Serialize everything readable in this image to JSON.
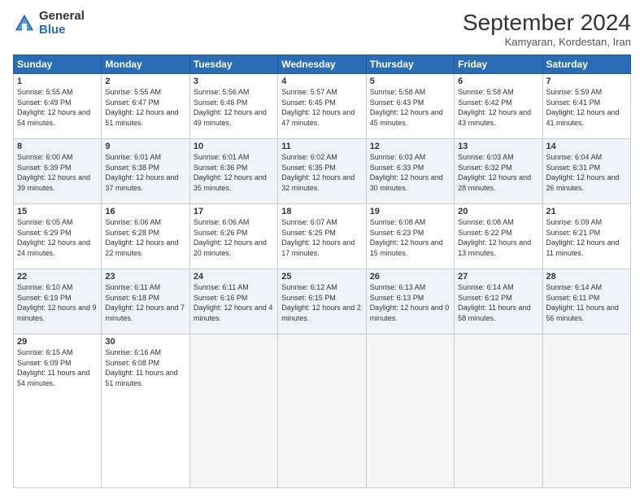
{
  "logo": {
    "general": "General",
    "blue": "Blue"
  },
  "title": "September 2024",
  "subtitle": "Kamyaran, Kordestan, Iran",
  "weekdays": [
    "Sunday",
    "Monday",
    "Tuesday",
    "Wednesday",
    "Thursday",
    "Friday",
    "Saturday"
  ],
  "weeks": [
    [
      {
        "day": "1",
        "sunrise": "5:55 AM",
        "sunset": "6:49 PM",
        "daylight": "12 hours and 54 minutes."
      },
      {
        "day": "2",
        "sunrise": "5:55 AM",
        "sunset": "6:47 PM",
        "daylight": "12 hours and 51 minutes."
      },
      {
        "day": "3",
        "sunrise": "5:56 AM",
        "sunset": "6:46 PM",
        "daylight": "12 hours and 49 minutes."
      },
      {
        "day": "4",
        "sunrise": "5:57 AM",
        "sunset": "6:45 PM",
        "daylight": "12 hours and 47 minutes."
      },
      {
        "day": "5",
        "sunrise": "5:58 AM",
        "sunset": "6:43 PM",
        "daylight": "12 hours and 45 minutes."
      },
      {
        "day": "6",
        "sunrise": "5:58 AM",
        "sunset": "6:42 PM",
        "daylight": "12 hours and 43 minutes."
      },
      {
        "day": "7",
        "sunrise": "5:59 AM",
        "sunset": "6:41 PM",
        "daylight": "12 hours and 41 minutes."
      }
    ],
    [
      {
        "day": "8",
        "sunrise": "6:00 AM",
        "sunset": "6:39 PM",
        "daylight": "12 hours and 39 minutes."
      },
      {
        "day": "9",
        "sunrise": "6:01 AM",
        "sunset": "6:38 PM",
        "daylight": "12 hours and 37 minutes."
      },
      {
        "day": "10",
        "sunrise": "6:01 AM",
        "sunset": "6:36 PM",
        "daylight": "12 hours and 35 minutes."
      },
      {
        "day": "11",
        "sunrise": "6:02 AM",
        "sunset": "6:35 PM",
        "daylight": "12 hours and 32 minutes."
      },
      {
        "day": "12",
        "sunrise": "6:03 AM",
        "sunset": "6:33 PM",
        "daylight": "12 hours and 30 minutes."
      },
      {
        "day": "13",
        "sunrise": "6:03 AM",
        "sunset": "6:32 PM",
        "daylight": "12 hours and 28 minutes."
      },
      {
        "day": "14",
        "sunrise": "6:04 AM",
        "sunset": "6:31 PM",
        "daylight": "12 hours and 26 minutes."
      }
    ],
    [
      {
        "day": "15",
        "sunrise": "6:05 AM",
        "sunset": "6:29 PM",
        "daylight": "12 hours and 24 minutes."
      },
      {
        "day": "16",
        "sunrise": "6:06 AM",
        "sunset": "6:28 PM",
        "daylight": "12 hours and 22 minutes."
      },
      {
        "day": "17",
        "sunrise": "6:06 AM",
        "sunset": "6:26 PM",
        "daylight": "12 hours and 20 minutes."
      },
      {
        "day": "18",
        "sunrise": "6:07 AM",
        "sunset": "6:25 PM",
        "daylight": "12 hours and 17 minutes."
      },
      {
        "day": "19",
        "sunrise": "6:08 AM",
        "sunset": "6:23 PM",
        "daylight": "12 hours and 15 minutes."
      },
      {
        "day": "20",
        "sunrise": "6:08 AM",
        "sunset": "6:22 PM",
        "daylight": "12 hours and 13 minutes."
      },
      {
        "day": "21",
        "sunrise": "6:09 AM",
        "sunset": "6:21 PM",
        "daylight": "12 hours and 11 minutes."
      }
    ],
    [
      {
        "day": "22",
        "sunrise": "6:10 AM",
        "sunset": "6:19 PM",
        "daylight": "12 hours and 9 minutes."
      },
      {
        "day": "23",
        "sunrise": "6:11 AM",
        "sunset": "6:18 PM",
        "daylight": "12 hours and 7 minutes."
      },
      {
        "day": "24",
        "sunrise": "6:11 AM",
        "sunset": "6:16 PM",
        "daylight": "12 hours and 4 minutes."
      },
      {
        "day": "25",
        "sunrise": "6:12 AM",
        "sunset": "6:15 PM",
        "daylight": "12 hours and 2 minutes."
      },
      {
        "day": "26",
        "sunrise": "6:13 AM",
        "sunset": "6:13 PM",
        "daylight": "12 hours and 0 minutes."
      },
      {
        "day": "27",
        "sunrise": "6:14 AM",
        "sunset": "6:12 PM",
        "daylight": "11 hours and 58 minutes."
      },
      {
        "day": "28",
        "sunrise": "6:14 AM",
        "sunset": "6:11 PM",
        "daylight": "11 hours and 56 minutes."
      }
    ],
    [
      {
        "day": "29",
        "sunrise": "6:15 AM",
        "sunset": "6:09 PM",
        "daylight": "11 hours and 54 minutes."
      },
      {
        "day": "30",
        "sunrise": "6:16 AM",
        "sunset": "6:08 PM",
        "daylight": "11 hours and 51 minutes."
      },
      null,
      null,
      null,
      null,
      null
    ]
  ]
}
